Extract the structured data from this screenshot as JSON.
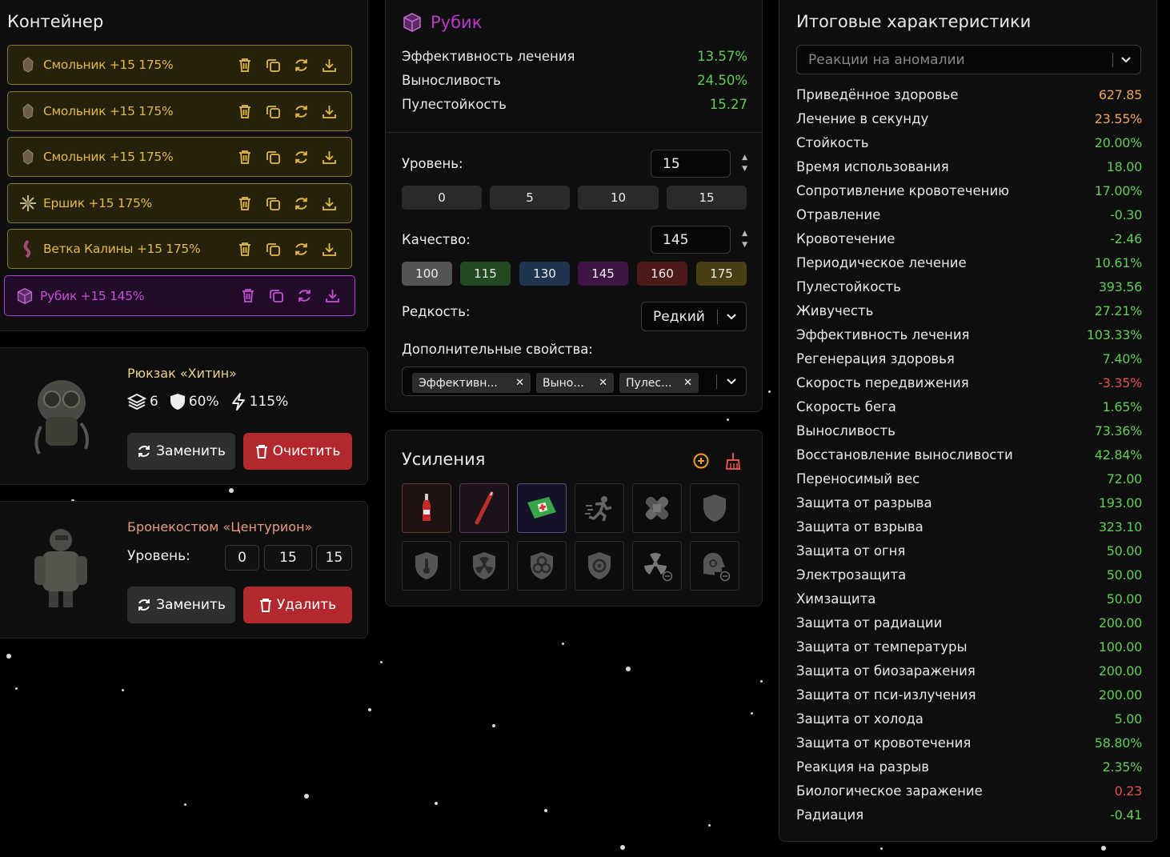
{
  "container": {
    "title": "Контейнер",
    "items": [
      {
        "label": "Смольник +15 175%",
        "icon": "smolnik-artifact-icon",
        "rarity": "gold"
      },
      {
        "label": "Смольник +15 175%",
        "icon": "smolnik-artifact-icon",
        "rarity": "gold"
      },
      {
        "label": "Смольник +15 175%",
        "icon": "smolnik-artifact-icon",
        "rarity": "gold"
      },
      {
        "label": "Ершик +15 175%",
        "icon": "ershik-artifact-icon",
        "rarity": "gold"
      },
      {
        "label": "Ветка Калины +15 175%",
        "icon": "kalina-artifact-icon",
        "rarity": "gold"
      },
      {
        "label": "Рубик +15 145%",
        "icon": "rubik-artifact-icon",
        "rarity": "purple"
      }
    ]
  },
  "backpack": {
    "title": "Рюкзак «Хитин»",
    "slots": "6",
    "protection": "60%",
    "energy": "115%",
    "replace_label": "Заменить",
    "clear_label": "Очистить"
  },
  "armor": {
    "title": "Бронекостюм «Центурион»",
    "level_label": "Уровень:",
    "levels": [
      "0",
      "15",
      "15"
    ],
    "replace_label": "Заменить",
    "delete_label": "Удалить"
  },
  "rubik": {
    "title": "Рубик",
    "props": [
      {
        "name": "Эффективность лечения",
        "value": "13.57%"
      },
      {
        "name": "Выносливость",
        "value": "24.50%"
      },
      {
        "name": "Пулестойкость",
        "value": "15.27"
      }
    ],
    "level_label": "Уровень:",
    "level_value": "15",
    "level_presets": [
      "0",
      "5",
      "10",
      "15"
    ],
    "quality_label": "Качество:",
    "quality_value": "145",
    "quality_presets": [
      {
        "label": "100",
        "color": "#555555"
      },
      {
        "label": "115",
        "color": "#1f4a22"
      },
      {
        "label": "130",
        "color": "#1f3450"
      },
      {
        "label": "145",
        "color": "#3f1545"
      },
      {
        "label": "160",
        "color": "#4d1a1a"
      },
      {
        "label": "175",
        "color": "#4a3f12"
      }
    ],
    "rarity_label": "Редкость:",
    "rarity_value": "Редкий",
    "extra_label": "Дополнительные свойства:",
    "extra_tags": [
      "Эффективн...",
      "Выно...",
      "Пулес..."
    ]
  },
  "boosts": {
    "title": "Усиления",
    "items": [
      {
        "name": "drink-bottle-icon",
        "active": true
      },
      {
        "name": "syringe-icon",
        "active": true
      },
      {
        "name": "medkit-icon",
        "active": true
      },
      {
        "name": "sprint-icon",
        "active": false
      },
      {
        "name": "bandage-icon",
        "active": false
      },
      {
        "name": "shield-icon",
        "active": false
      },
      {
        "name": "thermal-shield-icon",
        "active": false
      },
      {
        "name": "radiation-shield-icon",
        "active": false
      },
      {
        "name": "biohazard-shield-icon",
        "active": false
      },
      {
        "name": "psy-shield-icon",
        "active": false
      },
      {
        "name": "anti-radiation-icon",
        "active": false
      },
      {
        "name": "anti-psy-icon",
        "active": false
      }
    ]
  },
  "totals": {
    "title": "Итоговые характеристики",
    "filter_placeholder": "Реакции на аномалии",
    "stats": [
      {
        "name": "Приведённое здоровье",
        "value": "627.85",
        "color": "#f0a35a"
      },
      {
        "name": "Лечение в секунду",
        "value": "23.55%",
        "color": "#f0a35a"
      },
      {
        "name": "Стойкость",
        "value": "20.00%",
        "color": "#5fce52"
      },
      {
        "name": "Время использования",
        "value": "18.00",
        "color": "#5fce52"
      },
      {
        "name": "Сопротивление кровотечению",
        "value": "17.00%",
        "color": "#5fce52"
      },
      {
        "name": "Отравление",
        "value": "-0.30",
        "color": "#5fce52"
      },
      {
        "name": "Кровотечение",
        "value": "-2.46",
        "color": "#5fce52"
      },
      {
        "name": "Периодическое лечение",
        "value": "10.61%",
        "color": "#5fce52"
      },
      {
        "name": "Пулестойкость",
        "value": "393.56",
        "color": "#5fce52"
      },
      {
        "name": "Живучесть",
        "value": "27.21%",
        "color": "#5fce52"
      },
      {
        "name": "Эффективность лечения",
        "value": "103.33%",
        "color": "#5fce52"
      },
      {
        "name": "Регенерация здоровья",
        "value": "7.40%",
        "color": "#5fce52"
      },
      {
        "name": "Скорость передвижения",
        "value": "-3.35%",
        "color": "#e0524e"
      },
      {
        "name": "Скорость бега",
        "value": "1.65%",
        "color": "#5fce52"
      },
      {
        "name": "Выносливость",
        "value": "73.36%",
        "color": "#5fce52"
      },
      {
        "name": "Восстановление выносливости",
        "value": "42.84%",
        "color": "#5fce52"
      },
      {
        "name": "Переносимый вес",
        "value": "72.00",
        "color": "#5fce52"
      },
      {
        "name": "Защита от разрыва",
        "value": "193.00",
        "color": "#5fce52"
      },
      {
        "name": "Защита от взрыва",
        "value": "323.10",
        "color": "#5fce52"
      },
      {
        "name": "Защита от огня",
        "value": "50.00",
        "color": "#5fce52"
      },
      {
        "name": "Электрозащита",
        "value": "50.00",
        "color": "#5fce52"
      },
      {
        "name": "Химзащита",
        "value": "50.00",
        "color": "#5fce52"
      },
      {
        "name": "Защита от радиации",
        "value": "200.00",
        "color": "#5fce52"
      },
      {
        "name": "Защита от температуры",
        "value": "100.00",
        "color": "#5fce52"
      },
      {
        "name": "Защита от биозаражения",
        "value": "200.00",
        "color": "#5fce52"
      },
      {
        "name": "Защита от пси-излучения",
        "value": "200.00",
        "color": "#5fce52"
      },
      {
        "name": "Защита от холода",
        "value": "5.00",
        "color": "#5fce52"
      },
      {
        "name": "Защита от кровотечения",
        "value": "58.80%",
        "color": "#5fce52"
      },
      {
        "name": "Реакция на разрыв",
        "value": "2.35%",
        "color": "#5fce52"
      },
      {
        "name": "Биологическое заражение",
        "value": "0.23",
        "color": "#e0524e"
      },
      {
        "name": "Радиация",
        "value": "-0.41",
        "color": "#5fce52"
      }
    ]
  }
}
